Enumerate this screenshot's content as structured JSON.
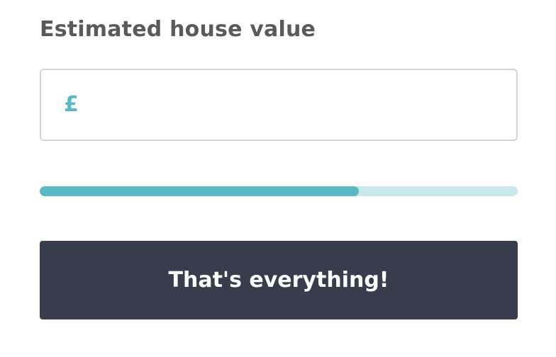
{
  "form": {
    "label": "Estimated house value",
    "currency_symbol": "£",
    "value": "",
    "placeholder": ""
  },
  "progress": {
    "fraction": 0.667
  },
  "submit": {
    "label": "That's everything!"
  },
  "colors": {
    "accent": "#5bb9c4",
    "track": "#c8e8ec",
    "button": "#383d4d",
    "label_text": "#5a5a5a"
  }
}
